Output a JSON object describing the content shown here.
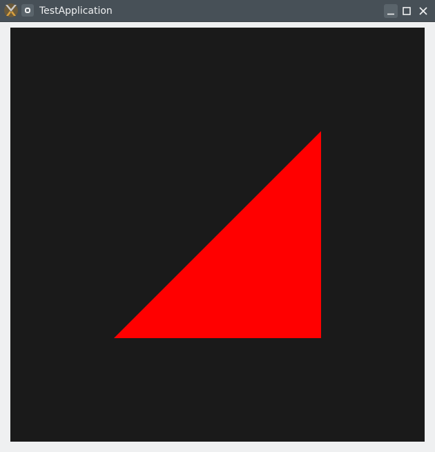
{
  "window": {
    "title": "TestApplication",
    "app_icon": "kde-app-icon",
    "menu_icon": "window-menu-icon",
    "buttons": {
      "minimize_icon": "minimize-icon",
      "maximize_icon": "maximize-icon",
      "close_icon": "close-icon"
    }
  },
  "canvas": {
    "background_color": "#1a1a1a",
    "shape": {
      "type": "triangle",
      "fill_color": "#ff0000"
    }
  }
}
